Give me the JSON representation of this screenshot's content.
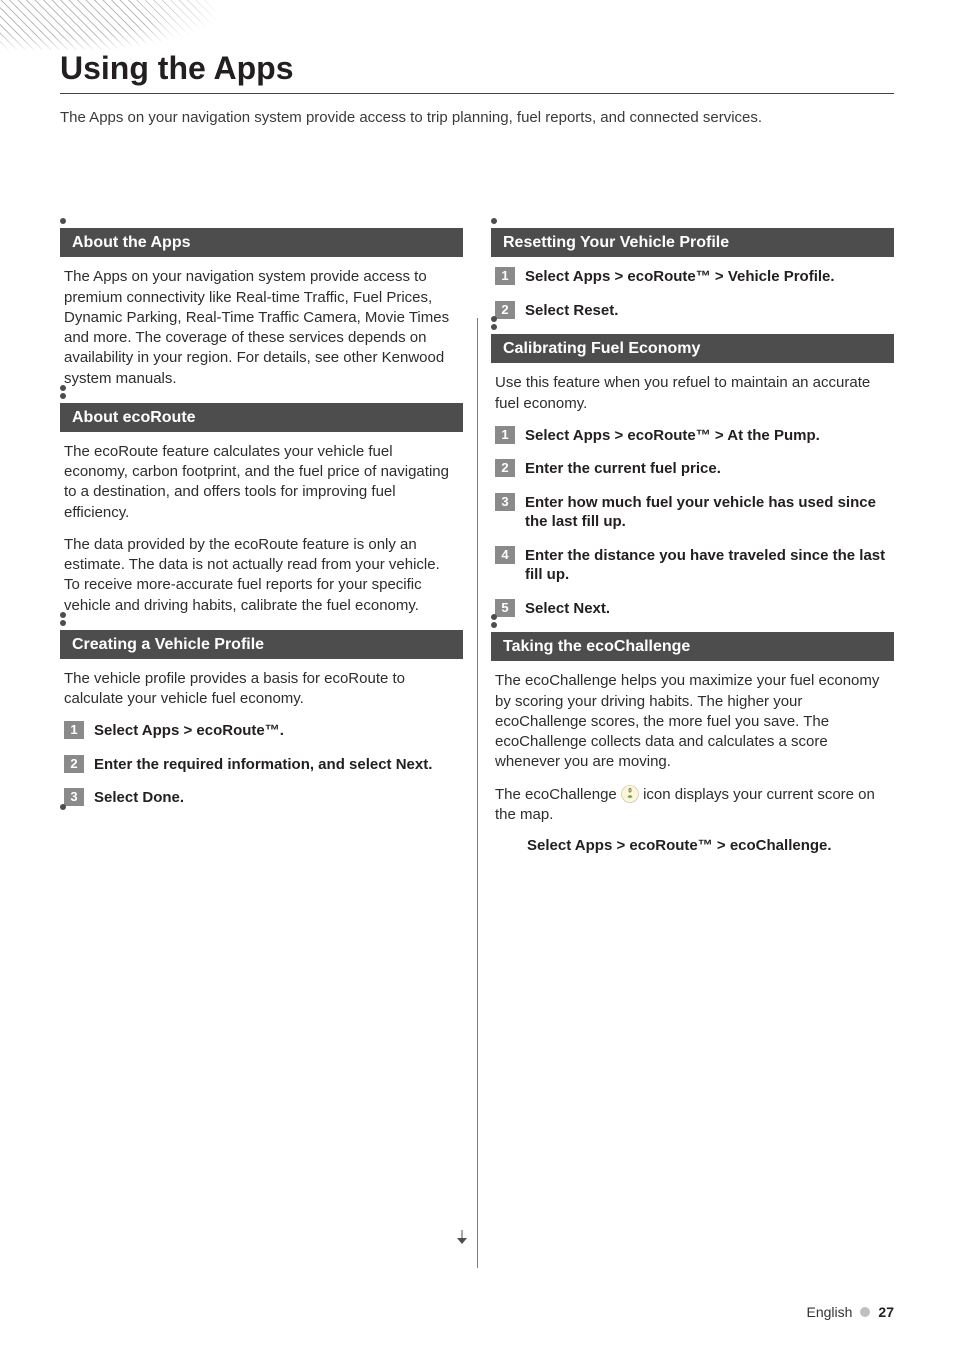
{
  "page_title": "Using the Apps",
  "intro": "The Apps on your navigation system provide access to trip planning, fuel reports, and connected services.",
  "left": {
    "sections": [
      {
        "heading": "About the Apps",
        "paragraphs": [
          "The Apps on your navigation system provide access to premium connectivity like Real-time Traffic, Fuel Prices, Dynamic Parking, Real-Time Traffic Camera,  Movie Times and more. The coverage of these services depends on availability in your region. For details, see other Kenwood system manuals."
        ]
      },
      {
        "heading": "About ecoRoute",
        "paragraphs": [
          "The ecoRoute feature calculates your vehicle fuel economy, carbon footprint, and the fuel price of navigating to a destination, and offers tools for improving fuel efficiency.",
          "The data provided by the ecoRoute feature is only an estimate. The data is not actually read from your vehicle. To receive more-accurate fuel reports for your specific vehicle and driving habits, calibrate the fuel economy."
        ]
      },
      {
        "heading": "Creating a Vehicle Profile",
        "paragraphs": [
          "The vehicle profile provides a basis for ecoRoute to calculate your vehicle fuel economy."
        ],
        "steps": [
          "Select Apps > ecoRoute™.",
          "Enter the required information, and select Next.",
          "Select Done."
        ]
      }
    ]
  },
  "right": {
    "sections": [
      {
        "heading": "Resetting Your Vehicle Profile",
        "steps": [
          "Select Apps > ecoRoute™ > Vehicle Profile.",
          "Select Reset."
        ]
      },
      {
        "heading": "Calibrating Fuel Economy",
        "paragraphs": [
          "Use this feature when you refuel to maintain an accurate fuel economy."
        ],
        "steps": [
          "Select Apps > ecoRoute™ > At the Pump.",
          "Enter the current fuel price.",
          "Enter how much fuel your vehicle has used since the last fill up.",
          "Enter the distance you have traveled since the last fill up.",
          "Select Next."
        ]
      },
      {
        "heading": "Taking the ecoChallenge",
        "paragraphs": [
          "The ecoChallenge helps you maximize your fuel economy by scoring your driving habits. The higher your ecoChallenge scores, the more fuel you save. The ecoChallenge collects data and calculates a score whenever you are moving."
        ],
        "icon_paragraph_before": "The ecoChallenge ",
        "icon_paragraph_after": " icon displays your current score on the map.",
        "single_action": "Select Apps > ecoRoute™ > ecoChallenge."
      }
    ]
  },
  "footer": {
    "language": "English",
    "page_number": "27"
  }
}
